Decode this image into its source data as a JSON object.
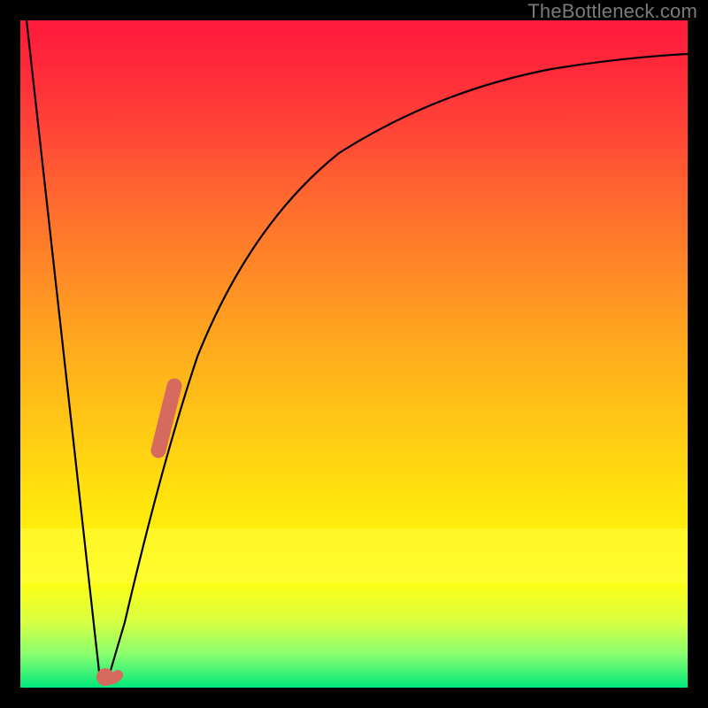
{
  "watermark": "TheBottleneck.com",
  "chart_data": {
    "type": "line",
    "title": "",
    "xlabel": "",
    "ylabel": "",
    "xlim": [
      0,
      100
    ],
    "ylim": [
      0,
      100
    ],
    "series": [
      {
        "name": "bottleneck-curve",
        "x": [
          0,
          2,
          4,
          6,
          8,
          9,
          10,
          11,
          12,
          13,
          14,
          16,
          18,
          20,
          22,
          25,
          30,
          35,
          40,
          45,
          50,
          55,
          60,
          65,
          70,
          75,
          80,
          85,
          90,
          95,
          100
        ],
        "y": [
          100,
          82,
          64,
          46,
          28,
          18,
          8,
          1,
          0,
          2,
          6,
          14,
          24,
          34,
          42,
          52,
          63,
          71,
          77,
          81,
          84,
          86.5,
          88.5,
          90,
          91,
          92,
          92.8,
          93.5,
          94,
          94.4,
          94.8
        ]
      }
    ],
    "markers": [
      {
        "name": "coral-spot",
        "x": 12.8,
        "y": 1.2,
        "r": 1.3,
        "color": "#d66a5e"
      },
      {
        "name": "coral-bar",
        "x1": 20.5,
        "y1": 35,
        "x2": 22.8,
        "y2": 45,
        "width": 2.1,
        "color": "#d66a5e"
      }
    ],
    "gradient_stops": [
      {
        "pos": 0,
        "color": "#ff1a3c"
      },
      {
        "pos": 50,
        "color": "#ffc116"
      },
      {
        "pos": 85,
        "color": "#f9ff1a"
      },
      {
        "pos": 100,
        "color": "#00e87a"
      }
    ]
  }
}
